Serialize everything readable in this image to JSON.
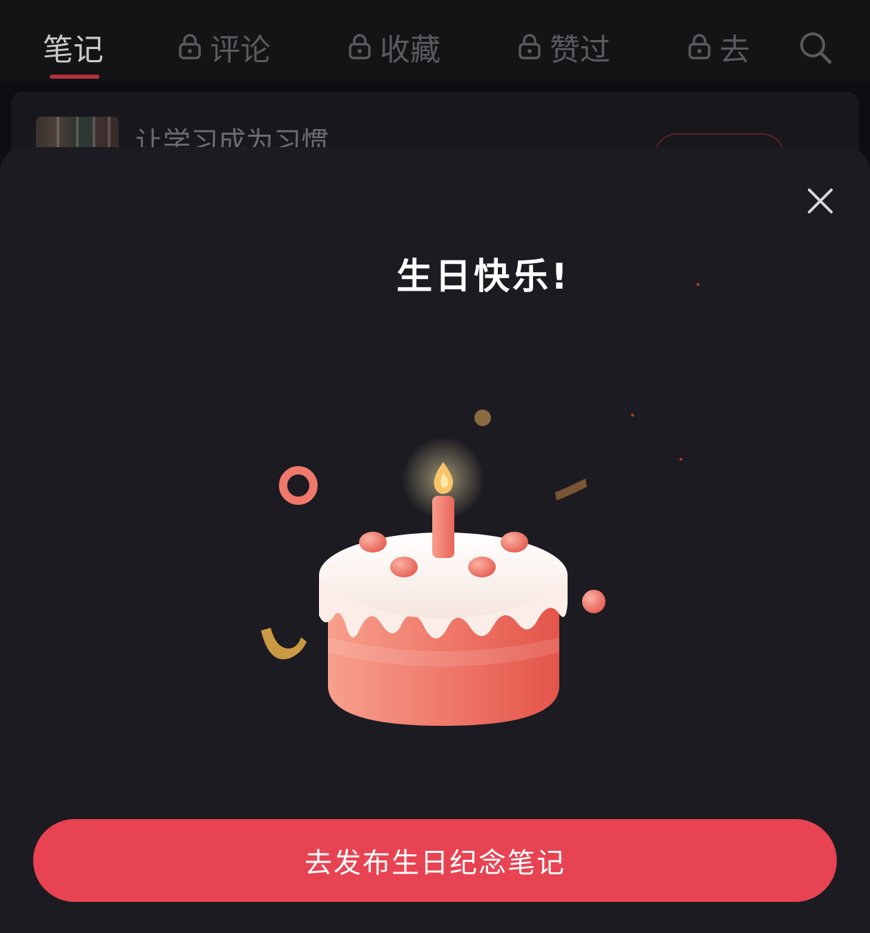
{
  "tabs": [
    {
      "label": "笔记",
      "locked": false,
      "active": true
    },
    {
      "label": "评论",
      "locked": true,
      "active": false
    },
    {
      "label": "收藏",
      "locked": true,
      "active": false
    },
    {
      "label": "赞过",
      "locked": true,
      "active": false
    },
    {
      "label": "去",
      "locked": true,
      "active": false
    }
  ],
  "search": {
    "icon": "search-icon"
  },
  "note": {
    "title": "让学习成为习惯"
  },
  "popup": {
    "title": "生日快乐!",
    "close_icon": "close-icon",
    "illustration": "birthday-cake-icon",
    "cta_label": "去发布生日纪念笔记"
  },
  "colors": {
    "accent": "#e84352",
    "sheet_background": "#1c1b22",
    "tab_underline": "#b3303d"
  }
}
